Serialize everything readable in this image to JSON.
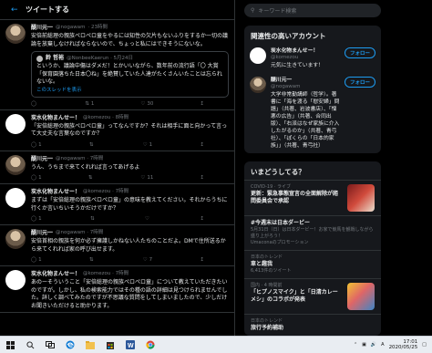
{
  "timeline": {
    "back_icon": "arrow-left-icon",
    "title": "ツイートする",
    "tweets": [
      {
        "name": "醍川元一",
        "handle": "@nogawam",
        "time": "· 23時間",
        "text": "安倍前総理の親族ペロペロ童をやるには知性の欠片もないふりをするか一切の議論を放棄しなければならないので、ちょっと私にはできそうにないな。",
        "quote": {
          "name": "鈴 哲裕",
          "handle": "@NonbeeKaerun · 5月24日",
          "text": "というか、議論中傷はダメだ！とかいいながら、数年前の流行語「〇 大賞「保育園落ちた日本〇ね」を絶賛していた人達がたくさんいたことは忘られないな。",
          "link": "このスレッドを表示"
        },
        "replies": "",
        "retweets": "1",
        "likes": "30"
      },
      {
        "name": "炭水化物まんせー！",
        "handle": "@komezou · 8時間",
        "text": "「安倍総理の親族ペロペロ童」ってなんですか？それは相手に面と向かって言って大丈夫な言葉なのですか？",
        "replies": "1",
        "retweets": "",
        "likes": "1"
      },
      {
        "name": "醍川元一",
        "handle": "@nogawam · 7時間",
        "text": "うん、うちまで来てくれれば言ってあげるよ",
        "replies": "1",
        "retweets": "",
        "likes": "11"
      },
      {
        "name": "炭水化物まんせー！",
        "handle": "@komezou · 7時間",
        "text": "まずは「安倍総理の親族ペロペロ童」の意味を教えてください。それからうちに行くか言いちいそうかだけですか？",
        "replies": "1",
        "retweets": "",
        "likes": ""
      },
      {
        "name": "醍川元一",
        "handle": "@nogawam · 7時間",
        "text": "安倍首相の親族を何か必ず擁護しかねない人たちのことだよ。DMで住所送るから来てくれれば家の呼び出せます。",
        "replies": "1",
        "retweets": "",
        "likes": "7"
      },
      {
        "name": "炭水化物まんせー！",
        "handle": "@komezou · 7時間",
        "text": "あのーそういうこと「安倍総理の親族ペロペロ童」について教えていただきたいのですが。しかし、私の検索能力ではその種の語の詳細は見つけられませんでした。詳しく調べてみたのですが不思議な質問をしてしまいましたので、少しだけお聞きいただけると助かります。",
        "replies": "",
        "retweets": "",
        "likes": ""
      }
    ]
  },
  "sidebar": {
    "search_placeholder": "キーワード検索",
    "related_title": "関連性の高いアカウント",
    "related": [
      {
        "name": "炭水化物まんせー！",
        "handle": "@komezou",
        "bio": "元気に生きています！",
        "follow_label": "フォロー"
      },
      {
        "name": "醍川元一",
        "handle": "@nogawam",
        "bio": "大学非常勤講師（哲学）。著書に「海を渡る「慰安婦」問題」（共著、岩波書店）、「憎悪の広告」（共著、合同出版）、「右派はなぜ家族に介入したがるのか」（共著、青弓社）、「ぽくらの「日本的家族」」（共著、青弓社）",
        "follow_label": "フォロー"
      }
    ],
    "trends_title": "いまどうしてる？",
    "trends": [
      {
        "meta": "COVID-19 · ライブ",
        "title": "更新：緊急事態宣言の全面解除が諮問委員会で承認",
        "sub": "",
        "thumb": true
      },
      {
        "meta": "",
        "title": "#今週末は日本ダービー",
        "sub": "5月31日（日）は日本ダービー！お家で競馬を観戦しながら盛り上がろう！",
        "promo": "Umaconaのプロモーション",
        "thumb": false
      },
      {
        "meta": "日本のトレンド",
        "title": "車と趣我",
        "sub": "6,413件のツイート",
        "thumb": false
      },
      {
        "meta": "国内 · 4 時間前",
        "title": "「ヒプノスマイク」と「日清カレーメシ」のコラボが発表",
        "sub": "",
        "thumb": true
      },
      {
        "meta": "日本のトレンド",
        "title": "旅行予約補助",
        "sub": "",
        "thumb": false
      }
    ]
  },
  "taskbar": {
    "time": "17:01",
    "date": "2020/05/25",
    "lang": "A"
  },
  "colors": {
    "accent": "#1d9bf0",
    "background": "#000000",
    "panel": "#16181c"
  }
}
